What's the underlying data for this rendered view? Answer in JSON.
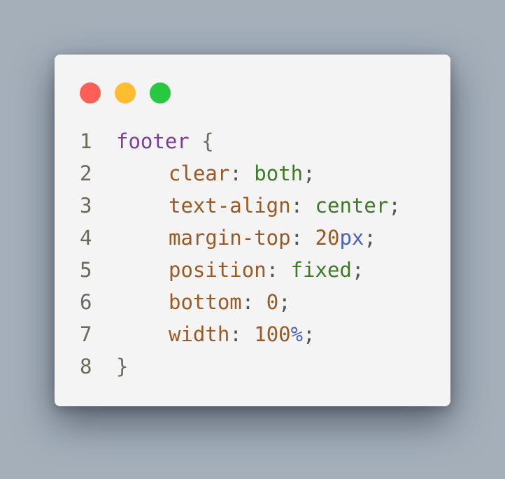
{
  "colors": {
    "window_dots": {
      "close": "#ff5f57",
      "minimize": "#febc2e",
      "maximize": "#28c840"
    },
    "line_number": "#6c6a5c",
    "selector": "#7b3f9a",
    "brace": "#6c6a5c",
    "property": "#9a5a22",
    "punctuation": "#555555",
    "keyword_value": "#3e7a26",
    "number": "#9a5a22",
    "unit": "#4a62bc"
  },
  "code": {
    "line_numbers": [
      "1",
      "2",
      "3",
      "4",
      "5",
      "6",
      "7",
      "8"
    ],
    "selector": "footer",
    "open_brace": "{",
    "close_brace": "}",
    "declarations": [
      {
        "property": "clear",
        "value": "both",
        "unit": ""
      },
      {
        "property": "text-align",
        "value": "center",
        "unit": ""
      },
      {
        "property": "margin-top",
        "value": "20",
        "unit": "px"
      },
      {
        "property": "position",
        "value": "fixed",
        "unit": ""
      },
      {
        "property": "bottom",
        "value": "0",
        "unit": ""
      },
      {
        "property": "width",
        "value": "100",
        "unit": "%"
      }
    ],
    "colon": ":",
    "semicolon": ";"
  }
}
